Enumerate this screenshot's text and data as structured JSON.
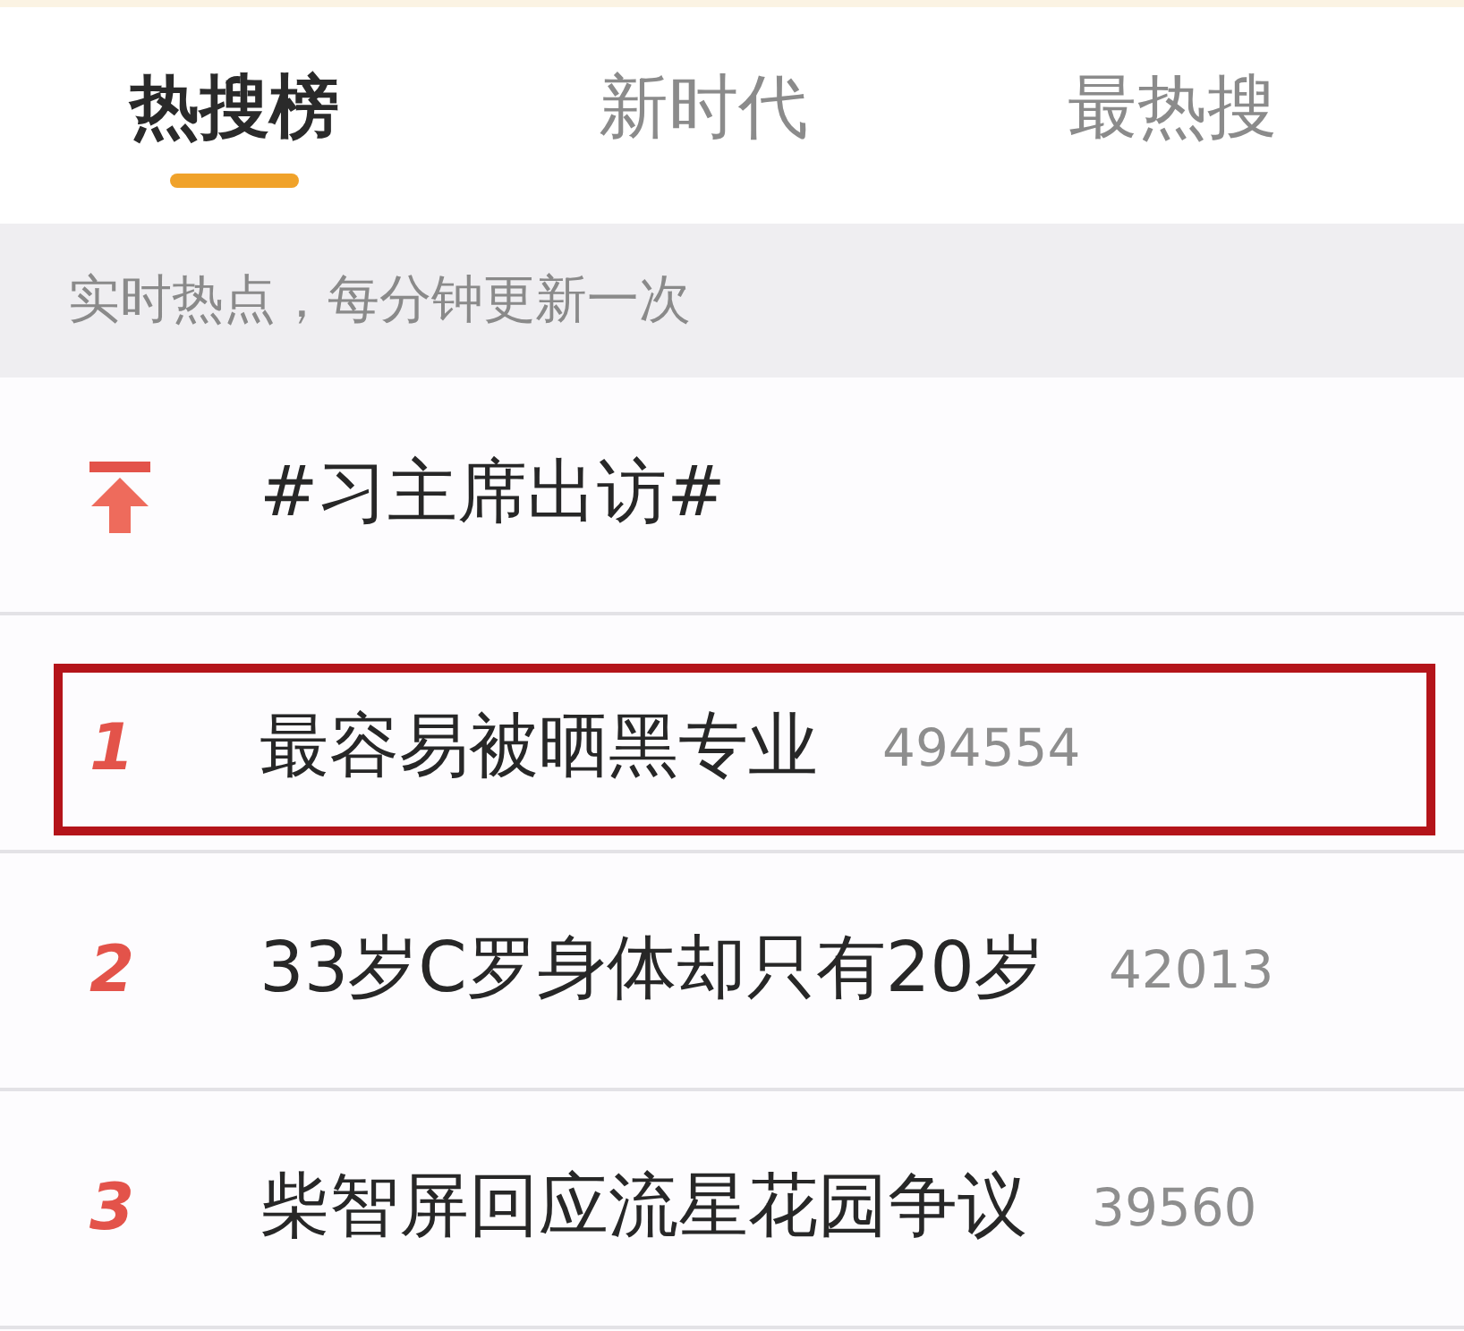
{
  "tabs": [
    {
      "label": "热搜榜",
      "selected": true
    },
    {
      "label": "新时代",
      "selected": false
    },
    {
      "label": "最热搜",
      "selected": false
    }
  ],
  "notice": "实时热点，每分钟更新一次",
  "items": [
    {
      "kind": "pinned",
      "title": "#习主席出访#",
      "highlighted": false
    },
    {
      "kind": "ranked",
      "rank": "1",
      "title": "最容易被晒黑专业",
      "count": "494554",
      "highlighted": true
    },
    {
      "kind": "ranked",
      "rank": "2",
      "title": "33岁C罗身体却只有20岁",
      "count": "42013",
      "highlighted": false
    },
    {
      "kind": "ranked",
      "rank": "3",
      "title": "柴智屏回应流星花园争议",
      "count": "39560",
      "highlighted": false
    }
  ]
}
